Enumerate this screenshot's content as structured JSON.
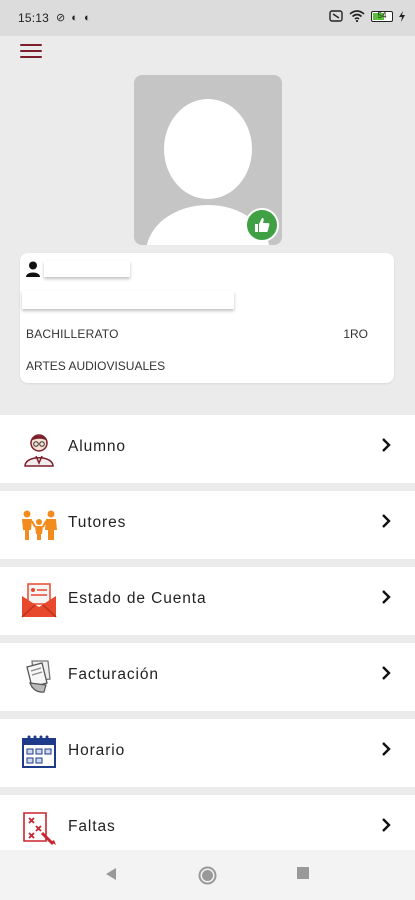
{
  "status_bar": {
    "time": "15:13",
    "battery_level": "54",
    "icons": [
      "mute-icon",
      "notification-icon",
      "notification-icon",
      "alarm-icon",
      "wifi-icon",
      "battery-icon",
      "charging-icon"
    ]
  },
  "profile": {
    "level": "BACHILLERATO",
    "grade": "1RO",
    "area": "ARTES AUDIOVISUALES"
  },
  "menu": {
    "items": [
      {
        "label": "Alumno",
        "icon": "student-icon"
      },
      {
        "label": "Tutores",
        "icon": "family-icon"
      },
      {
        "label": "Estado de Cuenta",
        "icon": "envelope-statement-icon"
      },
      {
        "label": "Facturación",
        "icon": "invoice-icon"
      },
      {
        "label": "Horario",
        "icon": "calendar-icon"
      },
      {
        "label": "Faltas",
        "icon": "absences-icon"
      }
    ]
  },
  "colors": {
    "accent": "#7a1f2b",
    "like_green": "#3fa144",
    "background": "#ebebeb"
  }
}
